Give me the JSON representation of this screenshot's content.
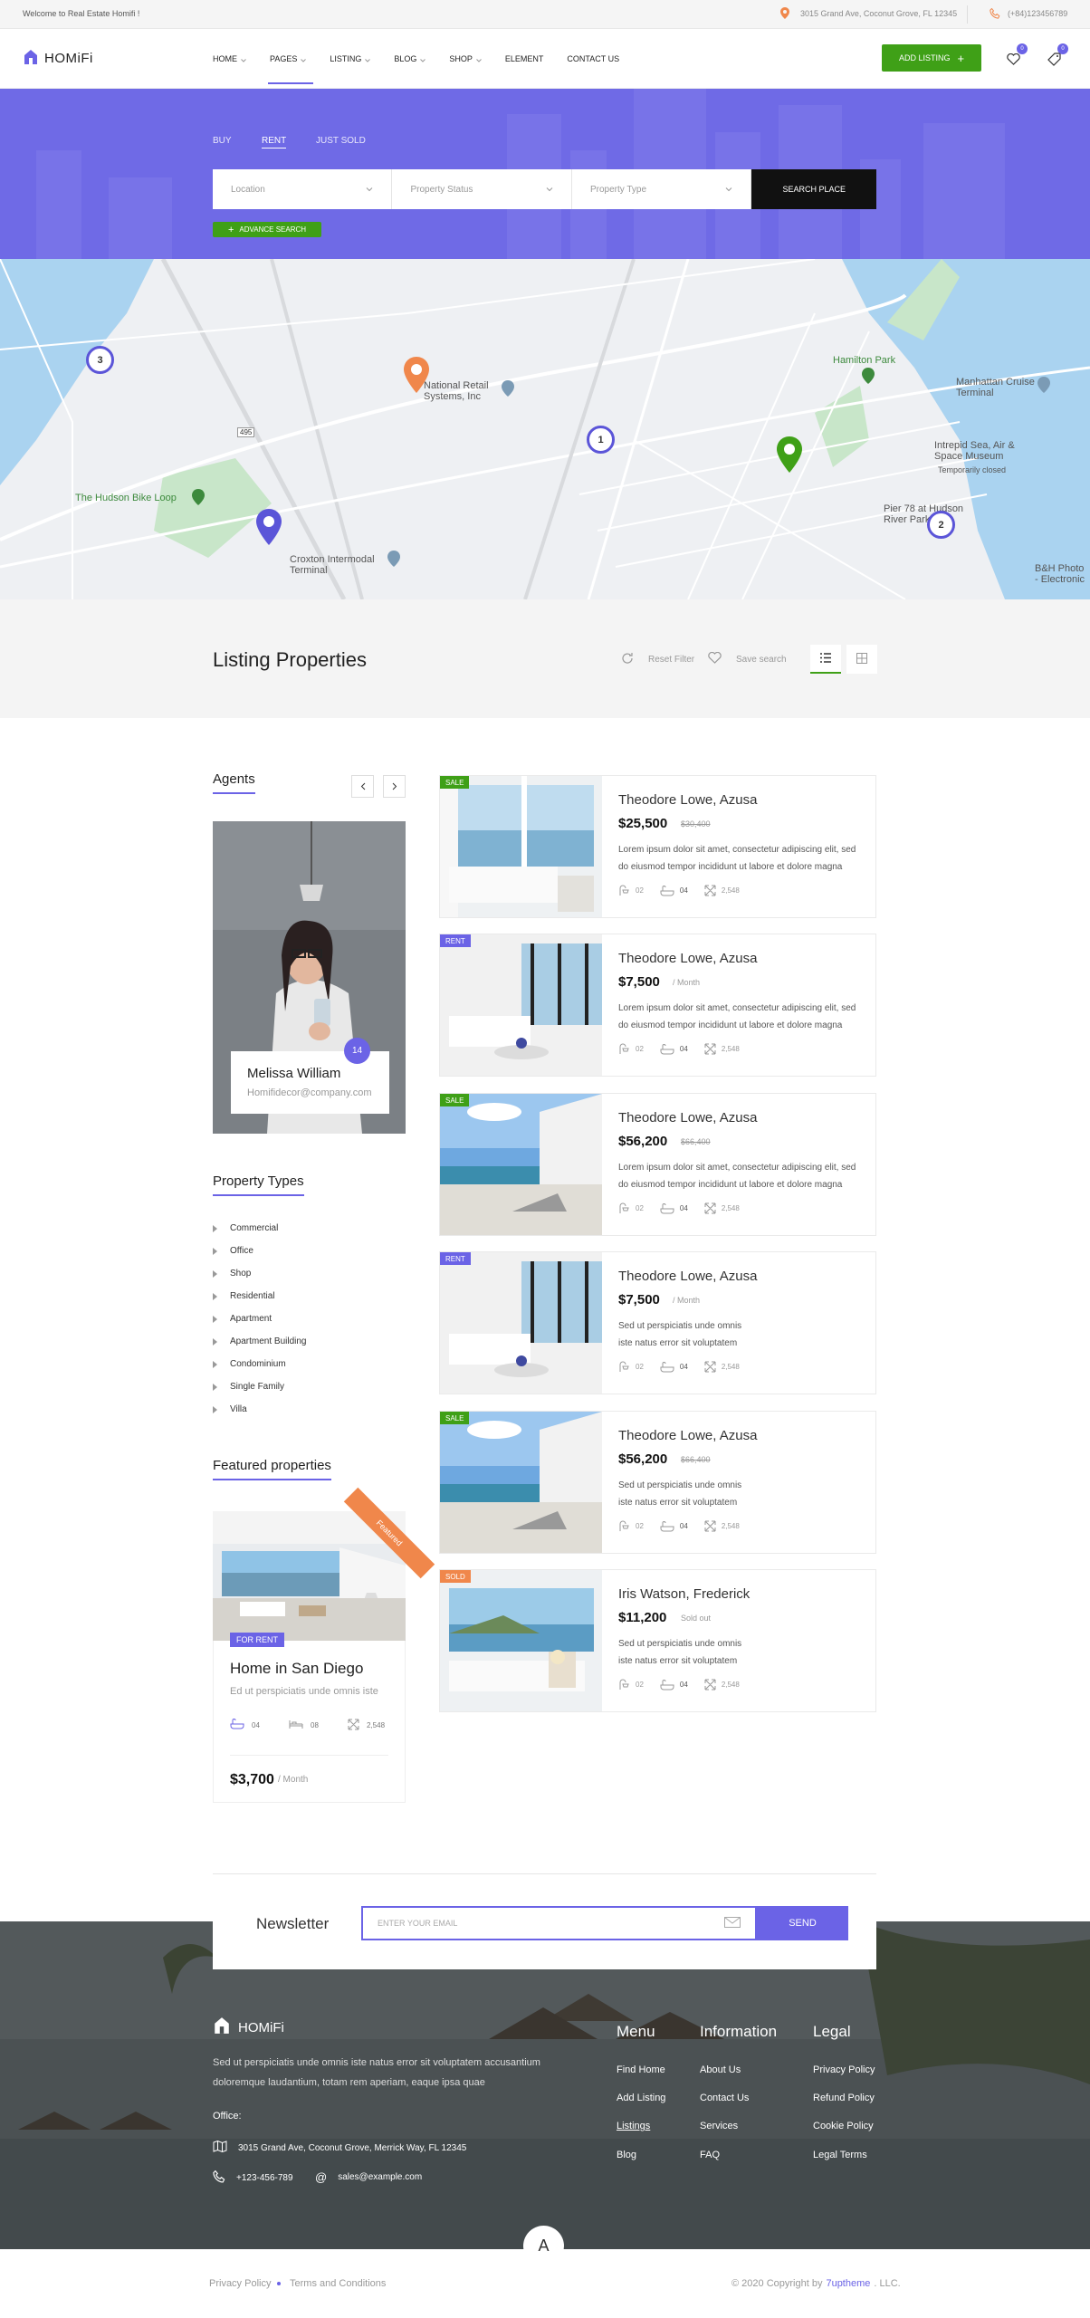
{
  "topbar": {
    "welcome": "Welcome to Real Estate Homifi !",
    "address": "3015 Grand Ave, Coconut Grove, FL 12345",
    "phone": "(+84)123456789"
  },
  "header": {
    "logo": "HOMiFi",
    "nav": [
      {
        "label": "HOME",
        "dropdown": true
      },
      {
        "label": "PAGES",
        "dropdown": true,
        "active": true
      },
      {
        "label": "LISTING",
        "dropdown": true
      },
      {
        "label": "BLOG",
        "dropdown": true
      },
      {
        "label": "SHOP",
        "dropdown": true
      },
      {
        "label": "ELEMENT",
        "dropdown": false
      },
      {
        "label": "CONTACT US",
        "dropdown": false
      }
    ],
    "add_listing": "ADD LISTING",
    "favorites_count": "0",
    "compare_count": "0"
  },
  "hero": {
    "tabs": [
      "BUY",
      "RENT",
      "JUST SOLD"
    ],
    "active_tab": "RENT",
    "location_placeholder": "Location",
    "status_placeholder": "Property Status",
    "type_placeholder": "Property Type",
    "search_button": "SEARCH PLACE",
    "advance_search": "ADVANCE SEARCH"
  },
  "map": {
    "labels": [
      "National Retail Systems, Inc",
      "Hamilton Park",
      "Manhattan Cruise Terminal",
      "Intrepid Sea, Air & Space Museum",
      "Temporarily closed",
      "Pier 78 at Hudson River Park",
      "The Hudson Bike Loop",
      "Croxton Intermodal Terminal",
      "B&H Photo - Electronic",
      "495"
    ],
    "clusters": [
      "3",
      "1",
      "2"
    ]
  },
  "listing_bar": {
    "title": "Listing Properties",
    "reset": "Reset Filter",
    "save": "Save search"
  },
  "sidebar": {
    "agents_title": "Agents",
    "agent": {
      "name": "Melissa William",
      "email": "Homifidecor@company.com",
      "count": "14"
    },
    "types_title": "Property Types",
    "types": [
      "Commercial",
      "Office",
      "Shop",
      "Residential",
      "Apartment",
      "Apartment Building",
      "Condominium",
      "Single Family",
      "Villa"
    ],
    "featured_title": "Featured properties",
    "featured": {
      "ribbon": "Featured",
      "badge": "FOR RENT",
      "title": "Home in San Diego",
      "desc": "Ed ut perspiciatis unde omnis iste",
      "beds": "04",
      "baths": "08",
      "area": "2,548",
      "price": "$3,700",
      "period": "/ Month"
    }
  },
  "properties": [
    {
      "tag": "SALE",
      "tag_color": "#3fa017",
      "title": "Theodore Lowe, Azusa",
      "price": "$25,500",
      "old": "$30,400",
      "old_strike": true,
      "desc": "Lorem ipsum dolor sit amet, consectetur adipiscing elit, sed do eiusmod tempor incididunt ut labore et dolore magna",
      "baths": "02",
      "beds": "04",
      "area": "2,548"
    },
    {
      "tag": "RENT",
      "tag_color": "#6b63e6",
      "title": "Theodore Lowe, Azusa",
      "price": "$7,500",
      "old": "/ Month",
      "old_strike": false,
      "desc": "Lorem ipsum dolor sit amet, consectetur adipiscing elit, sed do eiusmod tempor incididunt ut labore et dolore magna",
      "baths": "02",
      "beds": "04",
      "area": "2,548"
    },
    {
      "tag": "SALE",
      "tag_color": "#3fa017",
      "title": "Theodore Lowe, Azusa",
      "price": "$56,200",
      "old": "$66,400",
      "old_strike": true,
      "desc": "Lorem ipsum dolor sit amet, consectetur adipiscing elit, sed do eiusmod tempor incididunt ut labore et dolore magna",
      "baths": "02",
      "beds": "04",
      "area": "2,548"
    },
    {
      "tag": "RENT",
      "tag_color": "#6b63e6",
      "title": "Theodore Lowe, Azusa",
      "price": "$7,500",
      "old": "/ Month",
      "old_strike": false,
      "desc": "Sed ut perspiciatis unde omnis iste natus error sit voluptatem",
      "baths": "02",
      "beds": "04",
      "area": "2,548"
    },
    {
      "tag": "SALE",
      "tag_color": "#3fa017",
      "title": "Theodore Lowe, Azusa",
      "price": "$56,200",
      "old": "$66,400",
      "old_strike": true,
      "desc": "Sed ut perspiciatis unde omnis iste natus error sit voluptatem",
      "baths": "02",
      "beds": "04",
      "area": "2,548"
    },
    {
      "tag": "SOLD",
      "tag_color": "#f0874b",
      "title": "Iris Watson, Frederick",
      "price": "$11,200",
      "old": "Sold out",
      "old_strike": false,
      "desc": "Sed ut perspiciatis unde omnis iste natus error sit voluptatem",
      "baths": "02",
      "beds": "04",
      "area": "2,548"
    }
  ],
  "newsletter": {
    "title": "Newsletter",
    "placeholder": "ENTER YOUR EMAIL",
    "send": "SEND"
  },
  "footer": {
    "logo": "HOMiFi",
    "about": "Sed ut perspiciatis unde omnis iste natus error sit voluptatem accusantium doloremque laudantium, totam rem aperiam, eaque ipsa quae",
    "office": "Office:",
    "address": "3015 Grand Ave, Coconut Grove, Merrick Way, FL 12345",
    "phone": "+123-456-789",
    "email": "sales@example.com",
    "menu_title": "Menu",
    "menu": [
      "Find Home",
      "Add Listing",
      "Listings",
      "Blog"
    ],
    "info_title": "Information",
    "info": [
      "About Us",
      "Contact Us",
      "Services",
      "FAQ"
    ],
    "legal_title": "Legal",
    "legal": [
      "Privacy Policy",
      "Refund Policy",
      "Cookie Policy",
      "Legal Terms"
    ],
    "up": "A"
  },
  "bottom": {
    "privacy": "Privacy Policy",
    "terms": "Terms and Conditions",
    "copyright": "© 2020 Copyright by",
    "brand": "7uptheme",
    "llc": ". LLC."
  },
  "colors": {
    "accent": "#6b63e6",
    "green": "#3fa017",
    "orange": "#f0874b"
  }
}
